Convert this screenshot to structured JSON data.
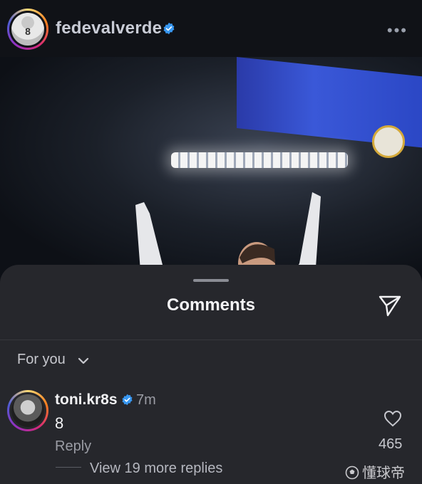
{
  "post": {
    "username": "fedevalverde",
    "verified": true,
    "more_icon": "more-horizontal-icon",
    "more_label": "•••",
    "avatar_number": "8",
    "photo": "celebration-photo"
  },
  "comments_sheet": {
    "title": "Comments",
    "filter_label": "For you",
    "share_icon": "send-icon"
  },
  "comment": {
    "username": "toni.kr8s",
    "verified": true,
    "time": "7m",
    "text": "8",
    "reply_label": "Reply",
    "likes": "465",
    "view_replies": "View 19 more replies"
  },
  "watermark": {
    "text": "懂球帝"
  },
  "colors": {
    "sheet_bg": "#26272c",
    "page_bg": "#0f1116",
    "verified_blue": "#3897f0"
  }
}
